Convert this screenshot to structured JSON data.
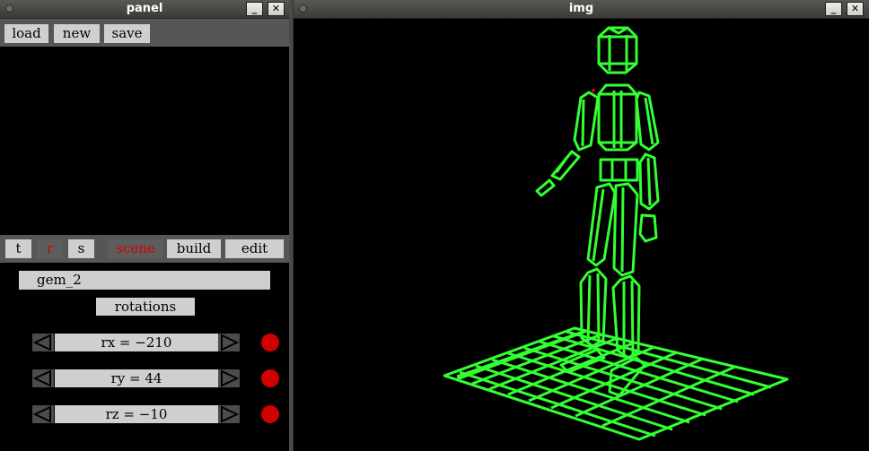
{
  "windows": {
    "panel": {
      "title": "panel",
      "minimize_glyph": "_",
      "close_glyph": "✕",
      "toolbar": {
        "load": "load",
        "new": "new",
        "save": "save"
      },
      "modes": {
        "t": "t",
        "r": "r",
        "s": "s"
      },
      "tabs": {
        "scene": "scene",
        "build": "build",
        "edit": "edit"
      },
      "object_name": "gem_2",
      "section_label": "rotations",
      "rotations": [
        {
          "label": "rx = −210"
        },
        {
          "label": "ry = 44"
        },
        {
          "label": "rz = −10"
        }
      ],
      "colors": {
        "accent_red": "#d10000",
        "button_gray": "#cfcfcf"
      }
    },
    "img": {
      "title": "img",
      "minimize_glyph": "_",
      "close_glyph": "✕",
      "colors": {
        "wireframe": "#33ff33",
        "background": "#000000"
      }
    }
  }
}
